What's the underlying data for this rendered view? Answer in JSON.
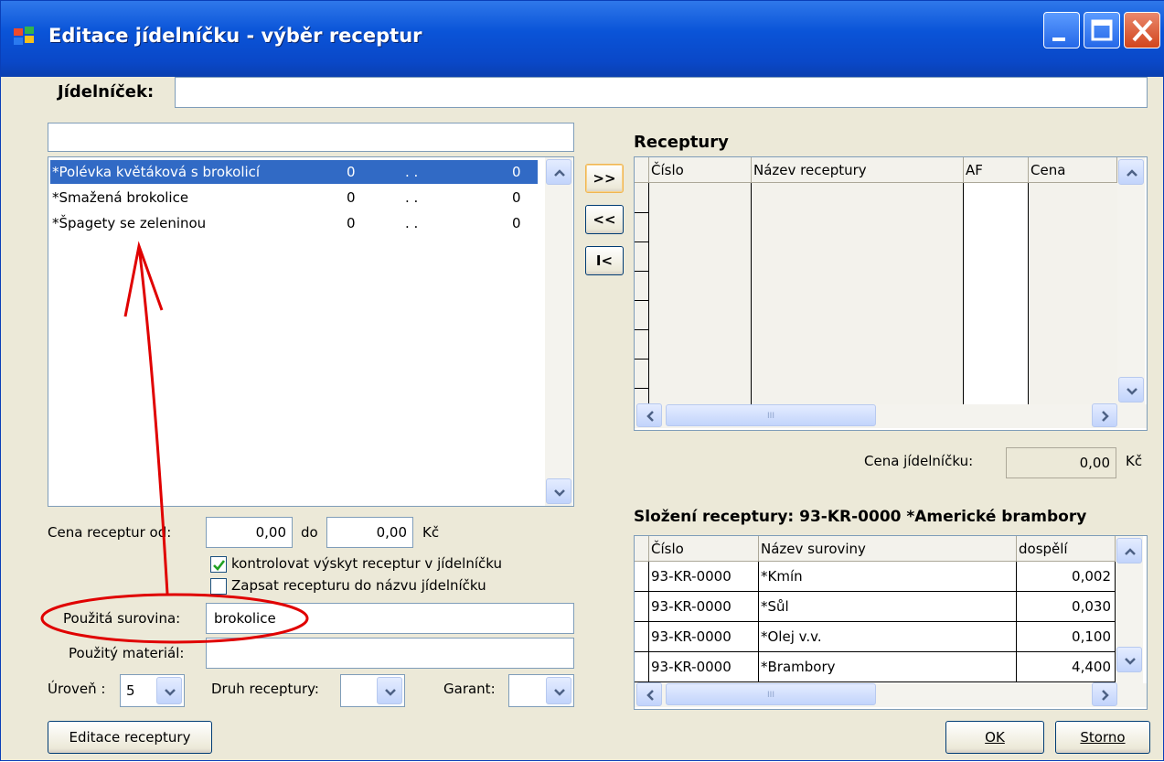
{
  "window": {
    "title": "Editace jídelníčku - výběr receptur"
  },
  "menu_field": {
    "label": "Jídelníček:",
    "value": ""
  },
  "filter_input": {
    "value": ""
  },
  "recipe_list": {
    "items": [
      {
        "name": "*Polévka květáková s brokolicí",
        "col2": "0",
        "col3": ". .",
        "col4": "0",
        "selected": true
      },
      {
        "name": "*Smažená brokolice",
        "col2": "0",
        "col3": ". .",
        "col4": "0",
        "selected": false
      },
      {
        "name": "*Špagety se zeleninou",
        "col2": "0",
        "col3": ". .",
        "col4": "0",
        "selected": false
      }
    ]
  },
  "transfer_buttons": {
    "add": ">>",
    "remove": "<<",
    "clear": "I<"
  },
  "receptury": {
    "title": "Receptury",
    "columns": [
      "Číslo",
      "Název receptury",
      "AF",
      "Cena"
    ],
    "scroll_mid": "III"
  },
  "menu_price": {
    "label": "Cena jídelníčku:",
    "value": "0,00",
    "unit": "Kč"
  },
  "composition": {
    "title": "Složení receptury: 93-KR-0000  *Americké brambory",
    "columns": [
      "Číslo",
      "Název suroviny",
      "dospělí"
    ],
    "rows": [
      {
        "cislo": "93-KR-0000",
        "nazev": "*Kmín",
        "dospeli": "0,002"
      },
      {
        "cislo": "93-KR-0000",
        "nazev": "*Sůl",
        "dospeli": "0,030"
      },
      {
        "cislo": "93-KR-0000",
        "nazev": "*Olej v.v.",
        "dospeli": "0,100"
      },
      {
        "cislo": "93-KR-0000",
        "nazev": "*Brambory",
        "dospeli": "4,400"
      }
    ],
    "scroll_mid": "III"
  },
  "price_filter": {
    "label": "Cena receptur od:",
    "from": "0,00",
    "to_label": "do",
    "to": "0,00",
    "unit": "Kč"
  },
  "checkboxes": {
    "check_occurrence": {
      "label": "kontrolovat výskyt receptur v jídelníčku",
      "checked": true
    },
    "write_name": {
      "label": "Zapsat recepturu do názvu jídelníčku",
      "checked": false
    }
  },
  "ingredient": {
    "label": "Použitá surovina:",
    "value": "brokolice"
  },
  "material": {
    "label": "Použitý materiál:",
    "value": ""
  },
  "level": {
    "label": "Úroveň :",
    "value": "5"
  },
  "recipe_type": {
    "label": "Druh receptury:",
    "value": ""
  },
  "guarantor": {
    "label": "Garant:",
    "value": ""
  },
  "buttons": {
    "edit_recipe": "Editace receptury",
    "ok": "OK",
    "cancel": "Storno"
  },
  "colors": {
    "titlebar": "#0a54d8",
    "selection": "#316ac5",
    "annotation": "#e00000"
  }
}
